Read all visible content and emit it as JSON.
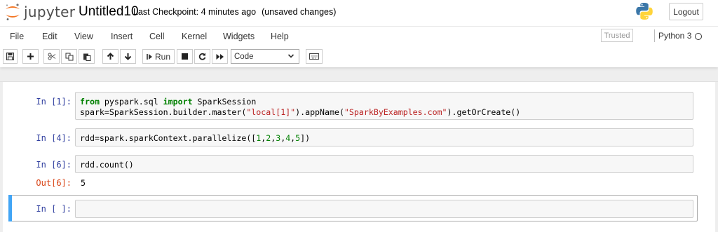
{
  "header": {
    "logo_text": "jupyter",
    "notebook_name": "Untitled10",
    "checkpoint": "Last Checkpoint: 4 minutes ago",
    "save_status": "(unsaved changes)",
    "logout_label": "Logout"
  },
  "menu": {
    "items": [
      "File",
      "Edit",
      "View",
      "Insert",
      "Cell",
      "Kernel",
      "Widgets",
      "Help"
    ],
    "trusted": "Trusted",
    "kernel_name": "Python 3"
  },
  "toolbar": {
    "run_label": "Run",
    "cell_type": "Code"
  },
  "cells": [
    {
      "prompt": "In [1]:",
      "lines": [
        [
          [
            "kw",
            "from"
          ],
          [
            "",
            "pyspark.sql "
          ],
          [
            "kw",
            "import"
          ],
          [
            "",
            " SparkSession"
          ]
        ],
        [
          [
            "",
            "spark=SparkSession.builder.master("
          ],
          [
            "str",
            "\"local[1]\""
          ],
          [
            "",
            ").appName("
          ],
          [
            "str",
            "\"SparkByExamples.com\""
          ],
          [
            "",
            ").getOrCreate()"
          ]
        ]
      ]
    },
    {
      "prompt": "In [4]:",
      "lines": [
        [
          [
            "",
            "rdd=spark.sparkContext.parallelize(["
          ],
          [
            "num",
            "1"
          ],
          [
            "",
            ","
          ],
          [
            "num",
            "2"
          ],
          [
            "",
            ","
          ],
          [
            "num",
            "3"
          ],
          [
            "",
            ","
          ],
          [
            "num",
            "4"
          ],
          [
            "",
            ","
          ],
          [
            "num",
            "5"
          ],
          [
            "",
            "])"
          ]
        ]
      ]
    },
    {
      "prompt": "In [6]:",
      "lines": [
        [
          [
            "",
            "rdd.count()"
          ]
        ]
      ],
      "output_prompt": "Out[6]:",
      "output": "5"
    },
    {
      "prompt": "In [ ]:",
      "lines": []
    }
  ]
}
